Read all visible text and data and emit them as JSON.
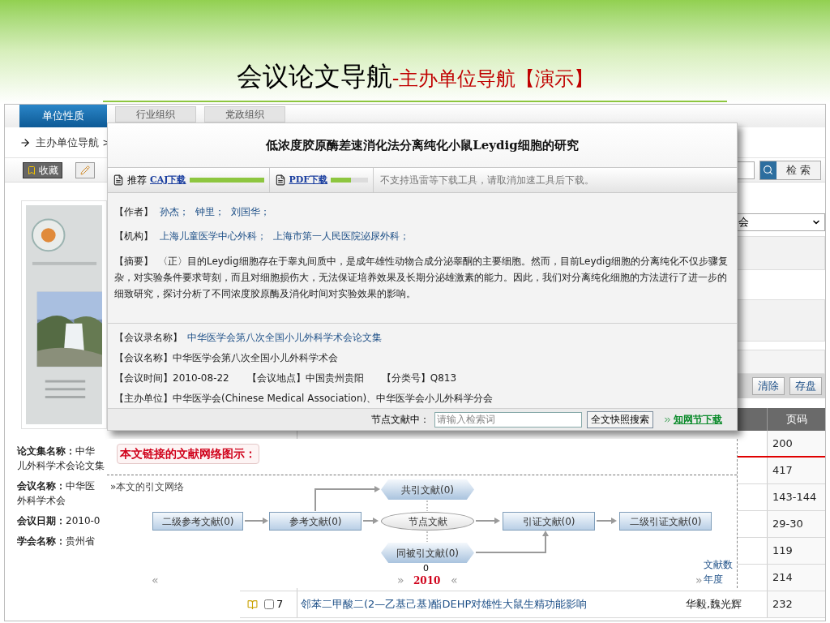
{
  "slide_title": {
    "main": "会议论文导航",
    "sub": "-主办单位导航【演示】"
  },
  "background_page": {
    "tabs": [
      {
        "label": "单位性质",
        "selected": true
      },
      {
        "label": "行业组织",
        "selected": false
      },
      {
        "label": "党政组织",
        "selected": false
      }
    ],
    "breadcrumb": "主办单位导航 >",
    "toolbar_button": "收藏",
    "search_button": "检 索",
    "dropdown_value": "会",
    "info": [
      {
        "label": "论文集名称：",
        "lines": [
          "中华",
          "儿外科学术会论文集"
        ]
      },
      {
        "label": "会议名称：",
        "lines": [
          "中华医",
          "外科学术会"
        ]
      },
      {
        "label": "会议日期：",
        "lines": [
          "2010-0"
        ]
      },
      {
        "label": "学会名称：",
        "lines": [
          "贵州省"
        ]
      }
    ],
    "table_buttons": [
      "清除",
      "存盘"
    ],
    "table": {
      "columns": [
        "页码"
      ],
      "rows": [
        {
          "pages": "200"
        },
        {
          "pages": "417"
        },
        {
          "pages": "143-144"
        },
        {
          "pages": "29-30"
        },
        {
          "pages": "119"
        },
        {
          "pages": "214"
        },
        {
          "number": "7",
          "checked": false,
          "title": "邻苯二甲酸二(2—乙基己基)酯DEHP对雄性大鼠生精功能影响",
          "authors": "华毅,魏光辉",
          "pages": "232"
        }
      ]
    }
  },
  "article_popup": {
    "title": "低浓度胶原酶差速消化法分离纯化小鼠Leydig细胞的研究",
    "downloads": [
      {
        "prefix": "推荐",
        "label": "CAJ下载",
        "level": 1
      },
      {
        "label": "PDF下载",
        "level": 0.55
      }
    ],
    "download_notice": "不支持迅雷等下载工具，请取消加速工具后下载。",
    "authors": {
      "label": "【作者】",
      "items": [
        "孙杰；",
        "钟里；",
        "刘国华；"
      ]
    },
    "institutions": {
      "label": "【机构】",
      "items": [
        "上海儿童医学中心外科；",
        "上海市第一人民医院泌尿外科；"
      ]
    },
    "abstract": {
      "label": "【摘要】",
      "text": "〈正〉目的Leydig细胞存在于睾丸间质中，是成年雄性动物合成分泌睾酮的主要细胞。然而，目前Leydig细胞的分离纯化不仅步骤复杂，对实验条件要求苛刻，而且对细胞损伤大，无法保证培养效果及长期分泌雄激素的能力。因此，我们对分离纯化细胞的方法进行了进一步的细致研究，探讨分析了不同浓度胶原酶及消化时间对实验效果的影响。"
    },
    "meeting_info": [
      {
        "fields": [
          {
            "label": "【会议录名称】",
            "value": "中华医学会第八次全国小儿外科学术会论文集",
            "kind": "link"
          }
        ]
      },
      {
        "fields": [
          {
            "label": "【会议名称】",
            "value": "中华医学会第八次全国小儿外科学术会",
            "kind": "text"
          }
        ]
      },
      {
        "fields": [
          {
            "label": "【会议时间】",
            "value": "2010-08-22",
            "kind": "text"
          },
          {
            "label": "【会议地点】",
            "value": "中国贵州贵阳",
            "kind": "text"
          },
          {
            "label": "【分类号】",
            "value": "Q813",
            "kind": "text"
          }
        ]
      },
      {
        "fields": [
          {
            "label": "【主办单位】",
            "value": "中华医学会(Chinese Medical Association)、中华医学会小儿外科学分会",
            "kind": "text"
          }
        ]
      }
    ],
    "node_search": {
      "label": "节点文献中：",
      "placeholder": "请输入检索词",
      "button": "全文快照搜索",
      "download_link": "知网节下载"
    }
  },
  "network_panel": {
    "heading": "本文链接的文献网络图示：",
    "subheading": "»本文的引文网络",
    "nodes": [
      {
        "label": "二级参考文献(0)",
        "kind": "box"
      },
      {
        "label": "参考文献(0)",
        "kind": "box"
      },
      {
        "label": "共引文献(0)",
        "kind": "tag"
      },
      {
        "label": "节点文献",
        "kind": "ellipse"
      },
      {
        "label": "同被引文献(0)",
        "kind": "tag"
      },
      {
        "label": "引证文献(0)",
        "kind": "box"
      },
      {
        "label": "二级引证文献(0)",
        "kind": "box"
      }
    ],
    "timeline": {
      "count": "0",
      "year": "2010",
      "count_label": "文献数",
      "year_label": "年度",
      "nav_marks": [
        "«",
        "»",
        "«",
        "»"
      ]
    }
  }
}
